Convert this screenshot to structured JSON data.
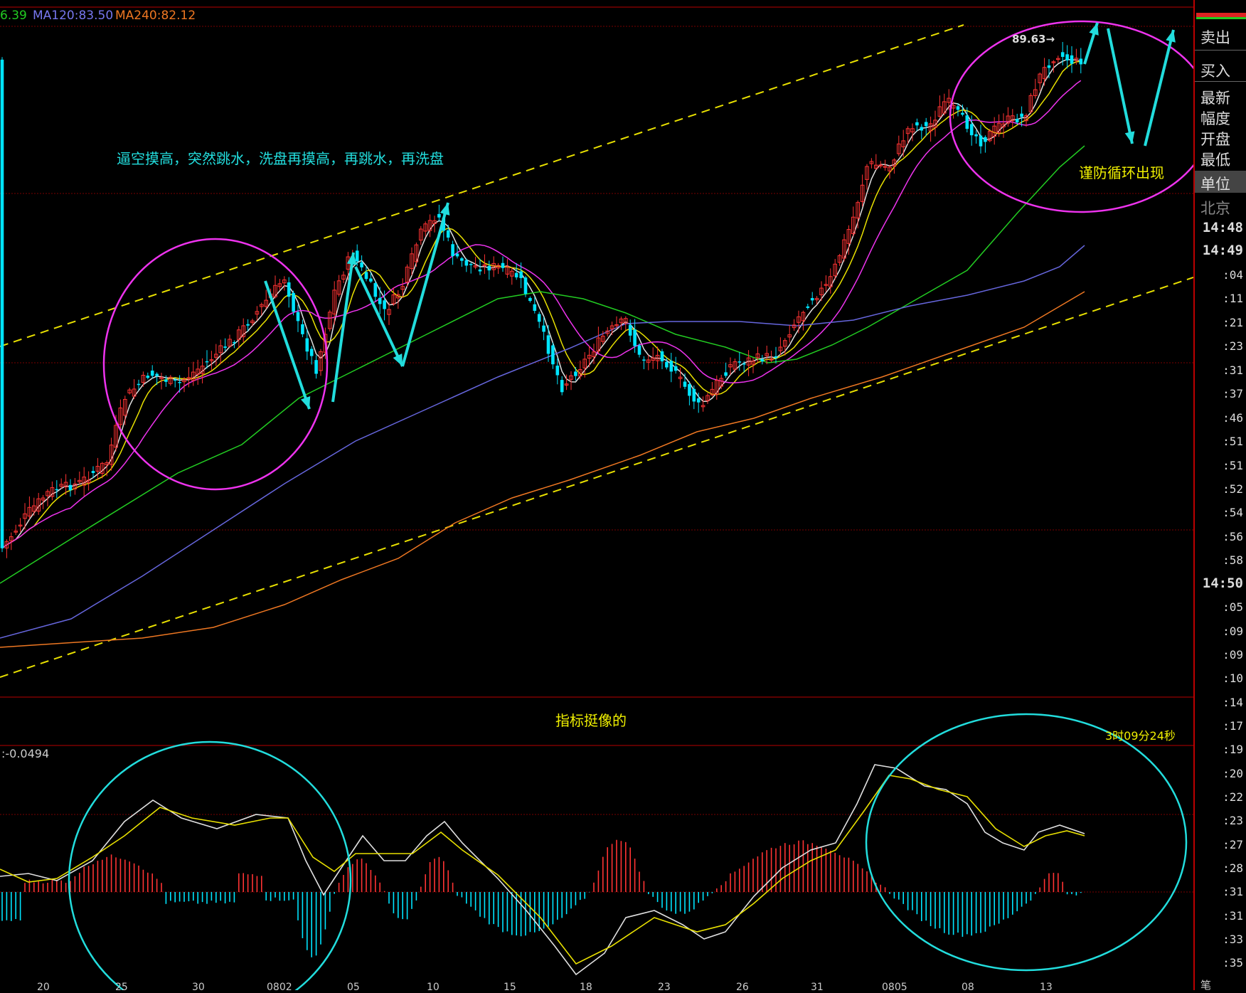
{
  "ma_labels": [
    {
      "text": "6.39",
      "color": "#22cc22"
    },
    {
      "text": "MA120:83.50",
      "color": "#7777ee"
    },
    {
      "text": "MA240:82.12",
      "color": "#ee7722"
    }
  ],
  "annotations": {
    "top_text": "逼空摸高，突然跳水，洗盘再摸高，再跳水，再洗盘",
    "right_text": "谨防循环出现",
    "price_label": "89.63→",
    "indicator_text": "指标挺像的",
    "macd_label": ":-0.0494",
    "timer": "3时09分24秒"
  },
  "sidebar": {
    "labels": [
      "卖出",
      "买入",
      "最新",
      "幅度",
      "开盘",
      "最低",
      "单位",
      "北京"
    ],
    "times": [
      "14:48",
      "14:49",
      ":04",
      ":11",
      ":21",
      ":23",
      ":31",
      ":37",
      ":46",
      ":51",
      ":51",
      ":52",
      ":54",
      ":56",
      ":58",
      "14:50",
      ":05",
      ":09",
      ":09",
      ":10",
      ":14",
      ":17",
      ":19",
      ":20",
      ":22",
      ":23",
      ":27",
      ":28",
      ":31",
      ":31",
      ":33",
      ":35"
    ],
    "bottom": "笔"
  },
  "x_axis_labels": [
    "20",
    "25",
    "30",
    "0802",
    "05",
    "10",
    "15",
    "18",
    "23",
    "26",
    "31",
    "0805",
    "08",
    "13"
  ],
  "colors": {
    "up": "#ff3333",
    "down": "#00e5ff",
    "ma5": "#e0e0e0",
    "ma10": "#e8e000",
    "ma20": "#ee33ee",
    "ma60": "#22cc22",
    "ma120": "#6666dd",
    "ma240": "#ee7722",
    "channel": "#e8e000",
    "circle_main": "#ee33ee",
    "circle_macd": "#22dddd",
    "arrow": "#22dddd"
  },
  "chart_data": {
    "type": "candlestick",
    "overlays": [
      "MA5",
      "MA10",
      "MA20",
      "MA60",
      "MA120",
      "MA240"
    ],
    "ma_values": {
      "MA120": 83.5,
      "MA240": 82.12
    },
    "last_high_marker": 89.63,
    "indicator": "MACD",
    "macd_value": -0.0494,
    "x_tick_labels": [
      "20",
      "25",
      "30",
      "0802",
      "05",
      "10",
      "15",
      "18",
      "23",
      "26",
      "31",
      "0805",
      "08",
      "13"
    ]
  }
}
